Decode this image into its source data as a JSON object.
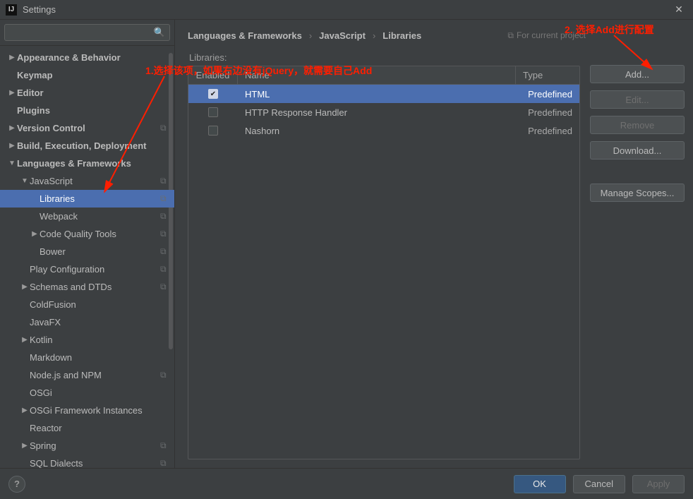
{
  "window": {
    "title": "Settings"
  },
  "search": {
    "placeholder": ""
  },
  "sidebar": {
    "items": [
      {
        "label": "Appearance & Behavior",
        "bold": true,
        "arrow": "right",
        "indent": 0
      },
      {
        "label": "Keymap",
        "bold": true,
        "indent": 0
      },
      {
        "label": "Editor",
        "bold": true,
        "arrow": "right",
        "indent": 0
      },
      {
        "label": "Plugins",
        "bold": true,
        "indent": 0
      },
      {
        "label": "Version Control",
        "bold": true,
        "arrow": "right",
        "indent": 0,
        "mod": true
      },
      {
        "label": "Build, Execution, Deployment",
        "bold": true,
        "arrow": "right",
        "indent": 0
      },
      {
        "label": "Languages & Frameworks",
        "bold": true,
        "arrow": "down",
        "indent": 0
      },
      {
        "label": "JavaScript",
        "arrow": "down",
        "indent": 1,
        "mod": true
      },
      {
        "label": "Libraries",
        "indent": 2,
        "mod": true,
        "selected": true
      },
      {
        "label": "Webpack",
        "indent": 2,
        "mod": true
      },
      {
        "label": "Code Quality Tools",
        "arrow": "right",
        "indent": 2,
        "mod": true
      },
      {
        "label": "Bower",
        "indent": 2,
        "mod": true
      },
      {
        "label": "Play Configuration",
        "indent": 1,
        "mod": true
      },
      {
        "label": "Schemas and DTDs",
        "arrow": "right",
        "indent": 1,
        "mod": true
      },
      {
        "label": "ColdFusion",
        "indent": 1
      },
      {
        "label": "JavaFX",
        "indent": 1
      },
      {
        "label": "Kotlin",
        "arrow": "right",
        "indent": 1
      },
      {
        "label": "Markdown",
        "indent": 1
      },
      {
        "label": "Node.js and NPM",
        "indent": 1,
        "mod": true
      },
      {
        "label": "OSGi",
        "indent": 1
      },
      {
        "label": "OSGi Framework Instances",
        "arrow": "right",
        "indent": 1
      },
      {
        "label": "Reactor",
        "indent": 1
      },
      {
        "label": "Spring",
        "arrow": "right",
        "indent": 1,
        "mod": true
      },
      {
        "label": "SQL Dialects",
        "indent": 1,
        "mod": true
      }
    ]
  },
  "breadcrumb": {
    "items": [
      "Languages & Frameworks",
      "JavaScript",
      "Libraries"
    ],
    "for_project": "For current project"
  },
  "libraries": {
    "title": "Libraries:",
    "columns": {
      "enabled": "Enabled",
      "name": "Name",
      "type": "Type"
    },
    "rows": [
      {
        "name": "HTML",
        "type": "Predefined",
        "enabled": true,
        "selected": true
      },
      {
        "name": "HTTP Response Handler",
        "type": "Predefined",
        "enabled": false
      },
      {
        "name": "Nashorn",
        "type": "Predefined",
        "enabled": false
      }
    ]
  },
  "buttons": {
    "add": "Add...",
    "edit": "Edit...",
    "remove": "Remove",
    "download": "Download...",
    "scopes": "Manage Scopes..."
  },
  "footer": {
    "ok": "OK",
    "cancel": "Cancel",
    "apply": "Apply"
  },
  "annotations": {
    "a1": "1.选择该项，如果右边没有jQuery，就需要自己Add",
    "a2": "2. 选择Add进行配置"
  }
}
